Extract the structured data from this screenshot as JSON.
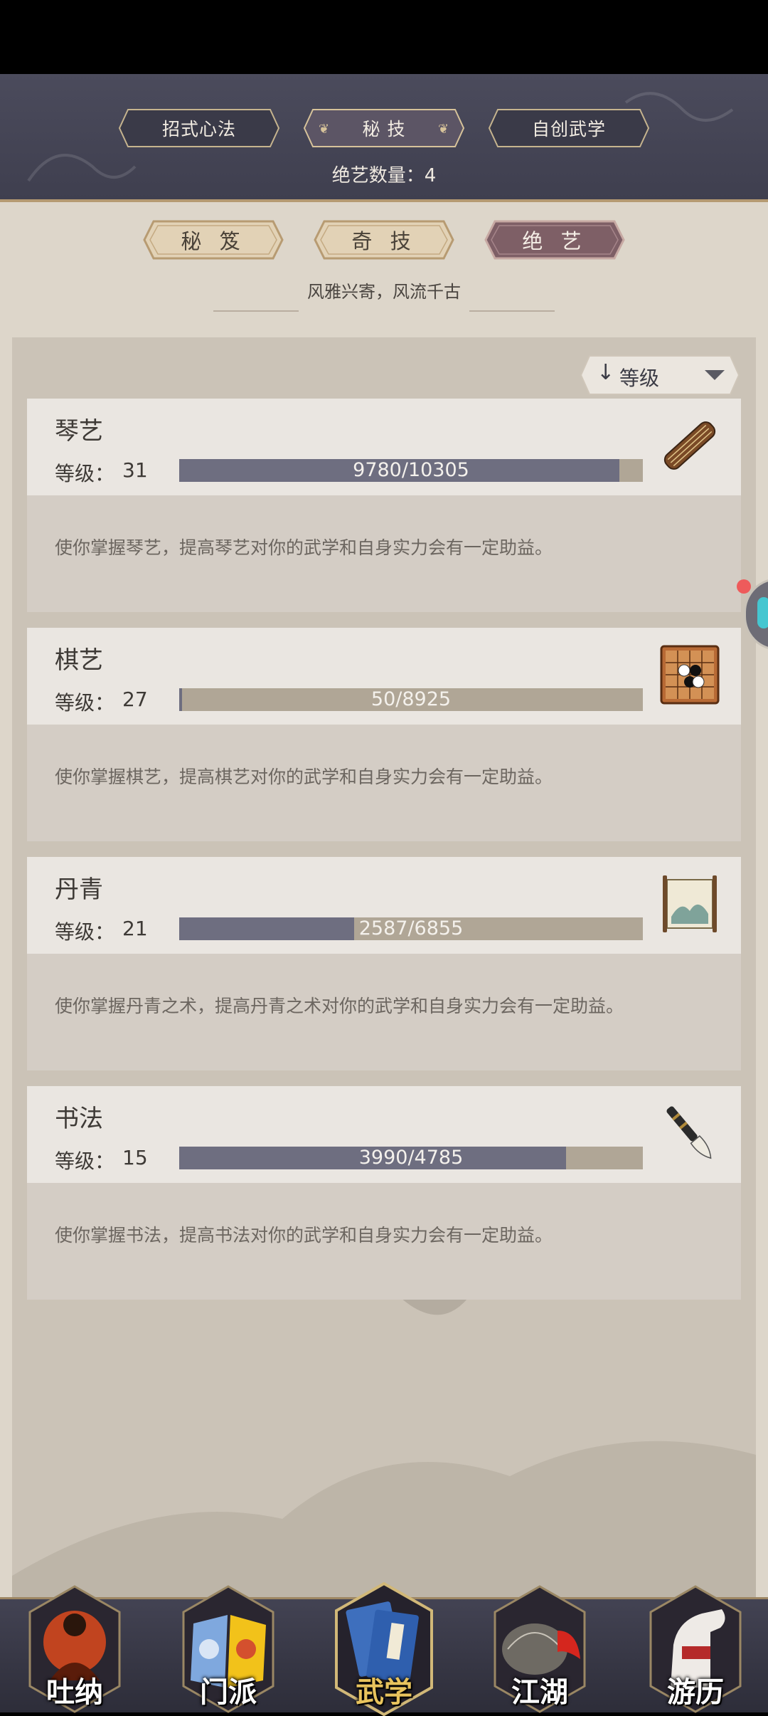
{
  "top_tabs": [
    {
      "label": "招式心法",
      "active": false
    },
    {
      "label": "秘 技",
      "active": true
    },
    {
      "label": "自创武学",
      "active": false
    }
  ],
  "count_line": "绝艺数量：4",
  "sub_tabs": [
    {
      "label": "秘 笈",
      "active": false
    },
    {
      "label": "奇 技",
      "active": false
    },
    {
      "label": "绝 艺",
      "active": true
    }
  ],
  "motto": "风雅兴寄，风流千古",
  "sort": {
    "arrow": "↓",
    "label": "等级",
    "icon": "caret-down-icon"
  },
  "level_label": "等级：",
  "skills": [
    {
      "name": "琴艺",
      "level": "31",
      "progress": "9780/10305",
      "progress_fraction": 0.949,
      "icon": "guqin-icon",
      "desc": "使你掌握琴艺，提高琴艺对你的武学和自身实力会有一定助益。"
    },
    {
      "name": "棋艺",
      "level": "27",
      "progress": "50/8925",
      "progress_fraction": 0.006,
      "icon": "go-board-icon",
      "desc": "使你掌握棋艺，提高棋艺对你的武学和自身实力会有一定助益。"
    },
    {
      "name": "丹青",
      "level": "21",
      "progress": "2587/6855",
      "progress_fraction": 0.377,
      "icon": "scroll-painting-icon",
      "desc": "使你掌握丹青之术，提高丹青之术对你的武学和自身实力会有一定助益。"
    },
    {
      "name": "书法",
      "level": "15",
      "progress": "3990/4785",
      "progress_fraction": 0.834,
      "icon": "brush-icon",
      "desc": "使你掌握书法，提高书法对你的武学和自身实力会有一定助益。"
    }
  ],
  "bottom_nav": [
    {
      "label": "吐纳",
      "icon": "meditating-monk-icon",
      "active": false
    },
    {
      "label": "门派",
      "icon": "sect-banner-icon",
      "active": false
    },
    {
      "label": "武学",
      "icon": "martial-book-icon",
      "active": true
    },
    {
      "label": "江湖",
      "icon": "bamboo-hat-icon",
      "active": false
    },
    {
      "label": "游历",
      "icon": "white-horse-icon",
      "active": false
    }
  ],
  "colors": {
    "header_bg": "#45455a",
    "content_bg": "#ddd6ca",
    "bar_fill": "#6e6e80",
    "bar_track": "#b0a696",
    "active_sub_tab": "#7e5f66",
    "nav_active": "#e8c35d"
  }
}
